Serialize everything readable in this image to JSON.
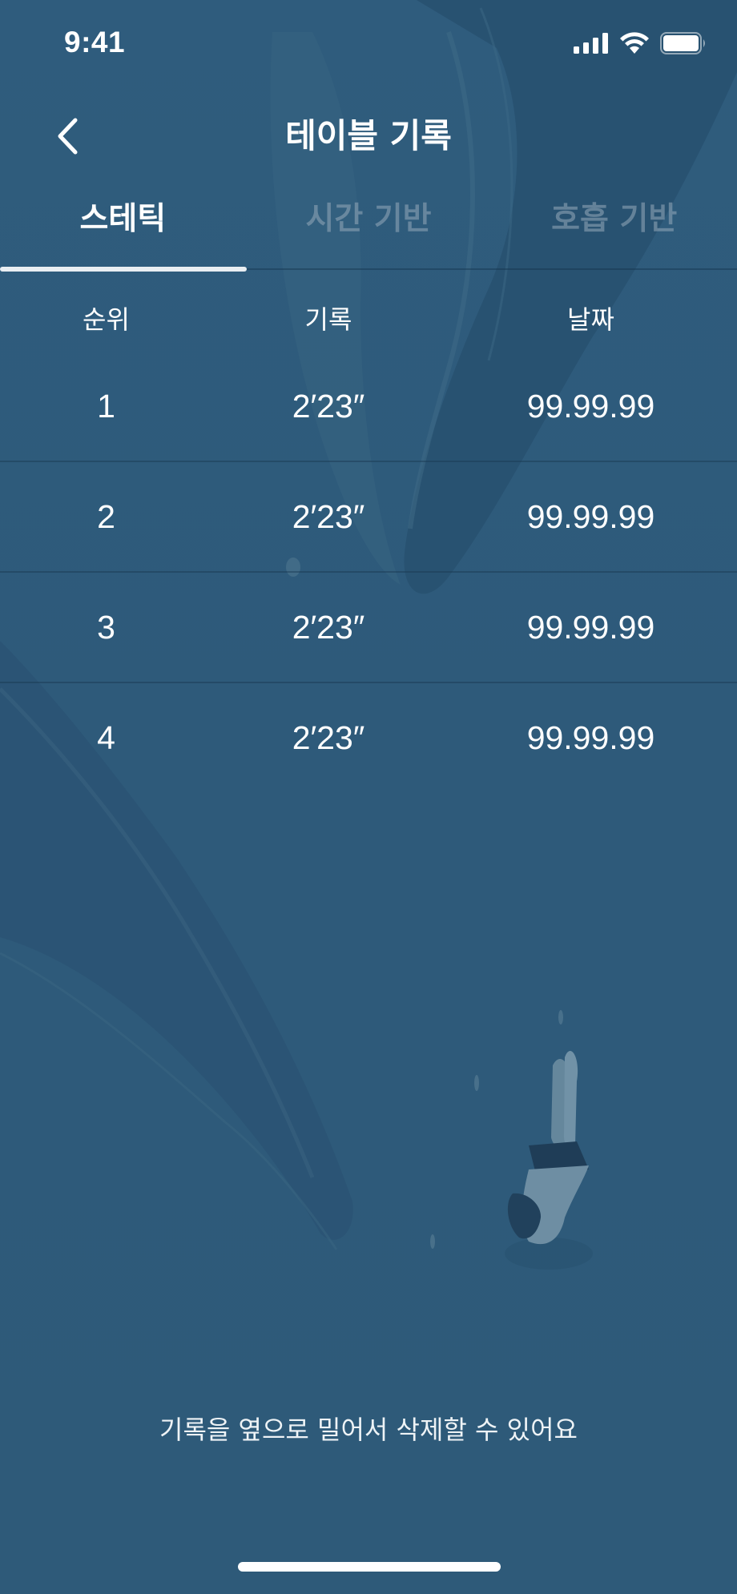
{
  "status_bar": {
    "time": "9:41",
    "icons": [
      "cellular-signal-icon",
      "wifi-icon",
      "battery-icon"
    ]
  },
  "nav": {
    "title": "테이블 기록",
    "back_icon": "chevron-left-icon"
  },
  "tabs": [
    {
      "label": "스테틱",
      "selected": true
    },
    {
      "label": "시간 기반",
      "selected": false
    },
    {
      "label": "호흡 기반",
      "selected": false
    }
  ],
  "table": {
    "columns": [
      "순위",
      "기록",
      "날짜"
    ],
    "rows": [
      {
        "rank": "1",
        "record": "2′23″",
        "date": "99.99.99"
      },
      {
        "rank": "2",
        "record": "2′23″",
        "date": "99.99.99"
      },
      {
        "rank": "3",
        "record": "2′23″",
        "date": "99.99.99"
      },
      {
        "rank": "4",
        "record": "2′23″",
        "date": "99.99.99"
      }
    ]
  },
  "hint": "기록을 옆으로 밀어서 삭제할 수 있어요",
  "colors": {
    "background": "#2e5a7a",
    "text": "#ffffff",
    "inactive_tab": "#8aa3b6"
  }
}
